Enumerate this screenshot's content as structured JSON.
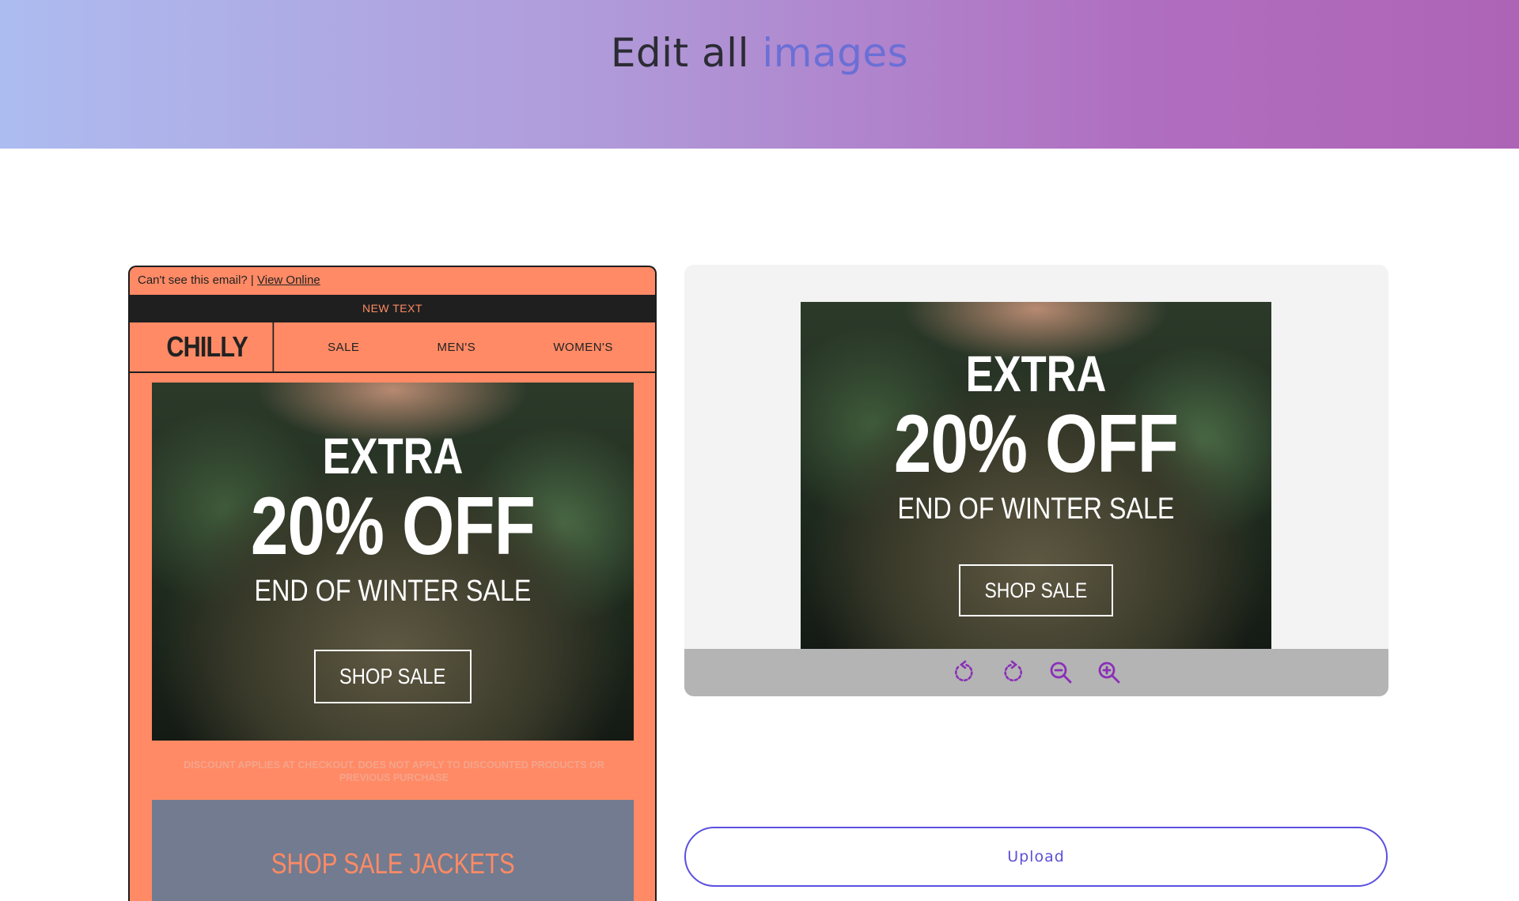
{
  "header": {
    "title_lead": "Edit all",
    "title_accent": "images"
  },
  "email": {
    "preheader_text": "Can't see this email? | ",
    "view_online_link": "View Online",
    "topbar_text": "NEW TEXT",
    "logo": "CHILLY",
    "nav": [
      "SALE",
      "MEN'S",
      "WOMEN'S"
    ],
    "banner": {
      "line1": "EXTRA",
      "line2": "20% OFF",
      "line3": "END OF WINTER SALE",
      "button": "SHOP SALE"
    },
    "disclaimer": "DISCOUNT APPLIES AT CHECKOUT. DOES NOT APPLY TO DISCOUNTED PRODUCTS OR PREVIOUS PURCHASE",
    "jackets_label": "SHOP SALE JACKETS"
  },
  "editor": {
    "image": {
      "line1": "EXTRA",
      "line2": "20% OFF",
      "line3": "END OF WINTER SALE",
      "button": "SHOP SALE"
    },
    "tools": [
      "rotate-left-icon",
      "rotate-right-icon",
      "zoom-out-icon",
      "zoom-in-icon"
    ]
  },
  "upload_label": "Upload",
  "colors": {
    "accent_purple": "#8a2fb8",
    "email_orange": "#ff8a65",
    "upload_border": "#5b4fe0"
  }
}
